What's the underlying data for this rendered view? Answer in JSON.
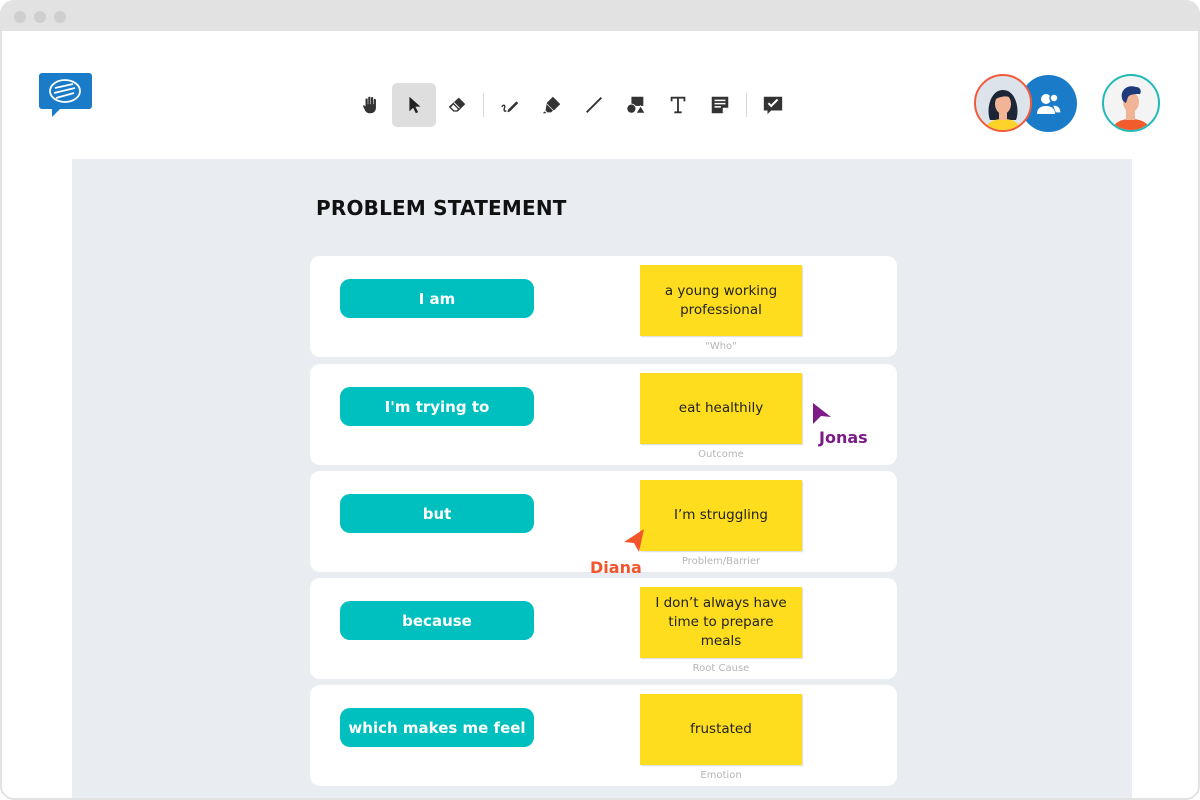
{
  "app": {
    "logo": "chat-bubble-logo-icon",
    "brand_color": "#1a7bc9"
  },
  "toolbar": {
    "tools": [
      {
        "name": "hand",
        "icon": "hand-icon",
        "label": "Pan"
      },
      {
        "name": "select",
        "icon": "cursor-arrow-icon",
        "label": "Select",
        "active": true
      },
      {
        "name": "eraser",
        "icon": "eraser-icon",
        "label": "Eraser"
      },
      {
        "name": "pen",
        "icon": "pen-icon",
        "label": "Pen"
      },
      {
        "name": "highlighter",
        "icon": "highlighter-icon",
        "label": "Highlighter"
      },
      {
        "name": "line",
        "icon": "line-icon",
        "label": "Line"
      },
      {
        "name": "shapes",
        "icon": "shapes-icon",
        "label": "Shapes"
      },
      {
        "name": "text",
        "icon": "text-icon",
        "label": "Text"
      },
      {
        "name": "sticky-note",
        "icon": "sticky-note-icon",
        "label": "Sticky note"
      },
      {
        "name": "comment",
        "icon": "comment-check-icon",
        "label": "Comment"
      }
    ]
  },
  "collaborators": [
    {
      "name": "Diana",
      "ring_color": "#f25b3a"
    },
    {
      "name": "Group",
      "icon": "users-icon"
    },
    {
      "name": "Jonas",
      "ring_color": "#22b9b9"
    }
  ],
  "board": {
    "title": "PROBLEM STATEMENT",
    "rows": [
      {
        "prompt": "I am",
        "answer": "a young working professional",
        "caption": "\"Who\""
      },
      {
        "prompt": "I'm trying to",
        "answer": "eat healthily",
        "caption": "Outcome"
      },
      {
        "prompt": "but",
        "answer": "I’m struggling",
        "caption": "Problem/Barrier"
      },
      {
        "prompt": "because",
        "answer": "I don’t always have time to prepare meals",
        "caption": "Root Cause"
      },
      {
        "prompt": "which makes me feel",
        "answer": "frustated",
        "caption": "Emotion"
      }
    ],
    "colors": {
      "pill": "#00bfbf",
      "sticky": "#fddd1e",
      "canvas": "#e9edf2"
    }
  },
  "cursors": [
    {
      "user": "Jonas",
      "color": "#7b1c87"
    },
    {
      "user": "Diana",
      "color": "#f2552c"
    }
  ]
}
